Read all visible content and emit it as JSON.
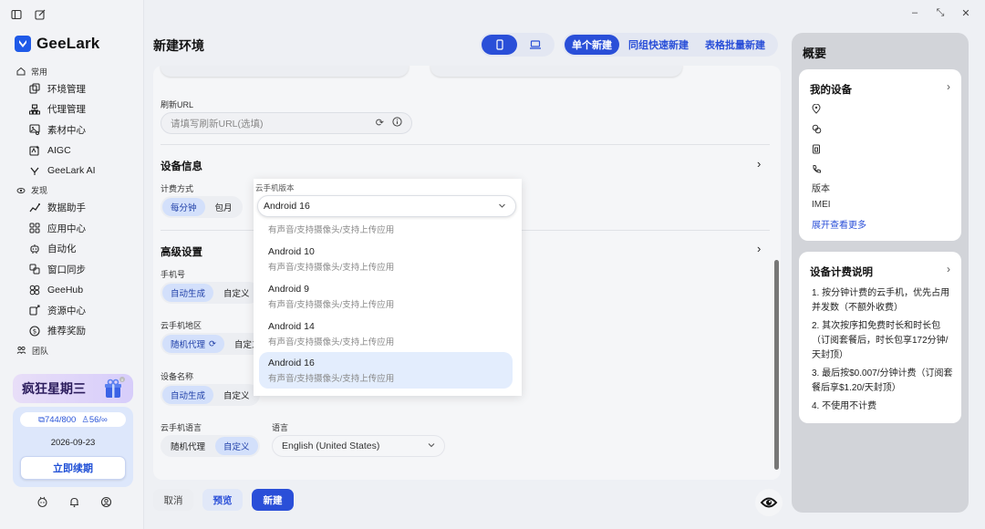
{
  "app": {
    "name": "GeeLark"
  },
  "sidebar": {
    "groups": [
      {
        "label": "常用",
        "icon": "home-icon"
      },
      {
        "label": "发现",
        "icon": "discover-icon"
      },
      {
        "label": "团队",
        "icon": "team-icon"
      }
    ],
    "common_items": [
      {
        "label": "环境管理",
        "icon": "profiles-icon"
      },
      {
        "label": "代理管理",
        "icon": "proxy-icon"
      },
      {
        "label": "素材中心",
        "icon": "materials-icon"
      },
      {
        "label": "AIGC",
        "icon": "aigc-icon"
      },
      {
        "label": "GeeLark AI",
        "icon": "ai-icon"
      }
    ],
    "discover_items": [
      {
        "label": "数据助手",
        "icon": "data-icon"
      },
      {
        "label": "应用中心",
        "icon": "apps-icon"
      },
      {
        "label": "自动化",
        "icon": "automation-icon"
      },
      {
        "label": "窗口同步",
        "icon": "sync-icon"
      },
      {
        "label": "GeeHub",
        "icon": "geehub-icon"
      },
      {
        "label": "资源中心",
        "icon": "resources-icon"
      },
      {
        "label": "推荐奖励",
        "icon": "referral-icon"
      }
    ],
    "promo": "疯狂星期三",
    "quota": {
      "profiles": "744/800",
      "members": "56/∞"
    },
    "expiry_date": "2026-09-23",
    "renew_label": "立即续期"
  },
  "header": {
    "title": "新建环境",
    "modes": [
      "单个新建",
      "同组快速新建",
      "表格批量新建"
    ],
    "active_mode": 0
  },
  "form": {
    "refresh_url_label": "刷新URL",
    "refresh_url_placeholder": "请填写刷新URL(选填)",
    "device_section": "设备信息",
    "billing_label": "计费方式",
    "billing_options": [
      "每分钟",
      "包月"
    ],
    "version_label": "云手机版本",
    "version_value": "Android 16",
    "advanced_section": "高级设置",
    "phone_label": "手机号",
    "phone_options": [
      "自动生成",
      "自定义"
    ],
    "region_label": "云手机地区",
    "region_options": [
      "随机代理",
      "自定义"
    ],
    "name_label": "设备名称",
    "name_options": [
      "自动生成",
      "自定义"
    ],
    "lang_label": "云手机语言",
    "lang_options": [
      "随机代理",
      "自定义"
    ],
    "language_label": "语言",
    "language_value": "English (United States)"
  },
  "dropdown": {
    "options": [
      {
        "name": "",
        "desc": "有声音/支持摄像头/支持上传应用"
      },
      {
        "name": "Android 10",
        "desc": "有声音/支持摄像头/支持上传应用"
      },
      {
        "name": "Android 9",
        "desc": "有声音/支持摄像头/支持上传应用"
      },
      {
        "name": "Android 14",
        "desc": "有声音/支持摄像头/支持上传应用"
      },
      {
        "name": "Android 16",
        "desc": "有声音/支持摄像头/支持上传应用"
      }
    ],
    "selected": "Android 16"
  },
  "footer": {
    "cancel": "取消",
    "preview": "预览",
    "create": "新建"
  },
  "overview": {
    "title": "概要",
    "my_devices": "我的设备",
    "version_row": "版本",
    "imei_row": "IMEI",
    "more_link": "展开查看更多",
    "billing_title": "设备计费说明",
    "billing_lines": [
      "1. 按分钟计费的云手机，优先占用并发数（不额外收费）",
      "2. 其次按序扣免费时长和时长包（订阅套餐后，时长包享172分钟/天封顶）",
      "3. 最后按$0.007/分钟计费（订阅套餐后享$1.20/天封顶）",
      "4. 不使用不计费"
    ]
  },
  "colors": {
    "accent": "#2a4fd8",
    "brand": "#1f5ae8"
  }
}
